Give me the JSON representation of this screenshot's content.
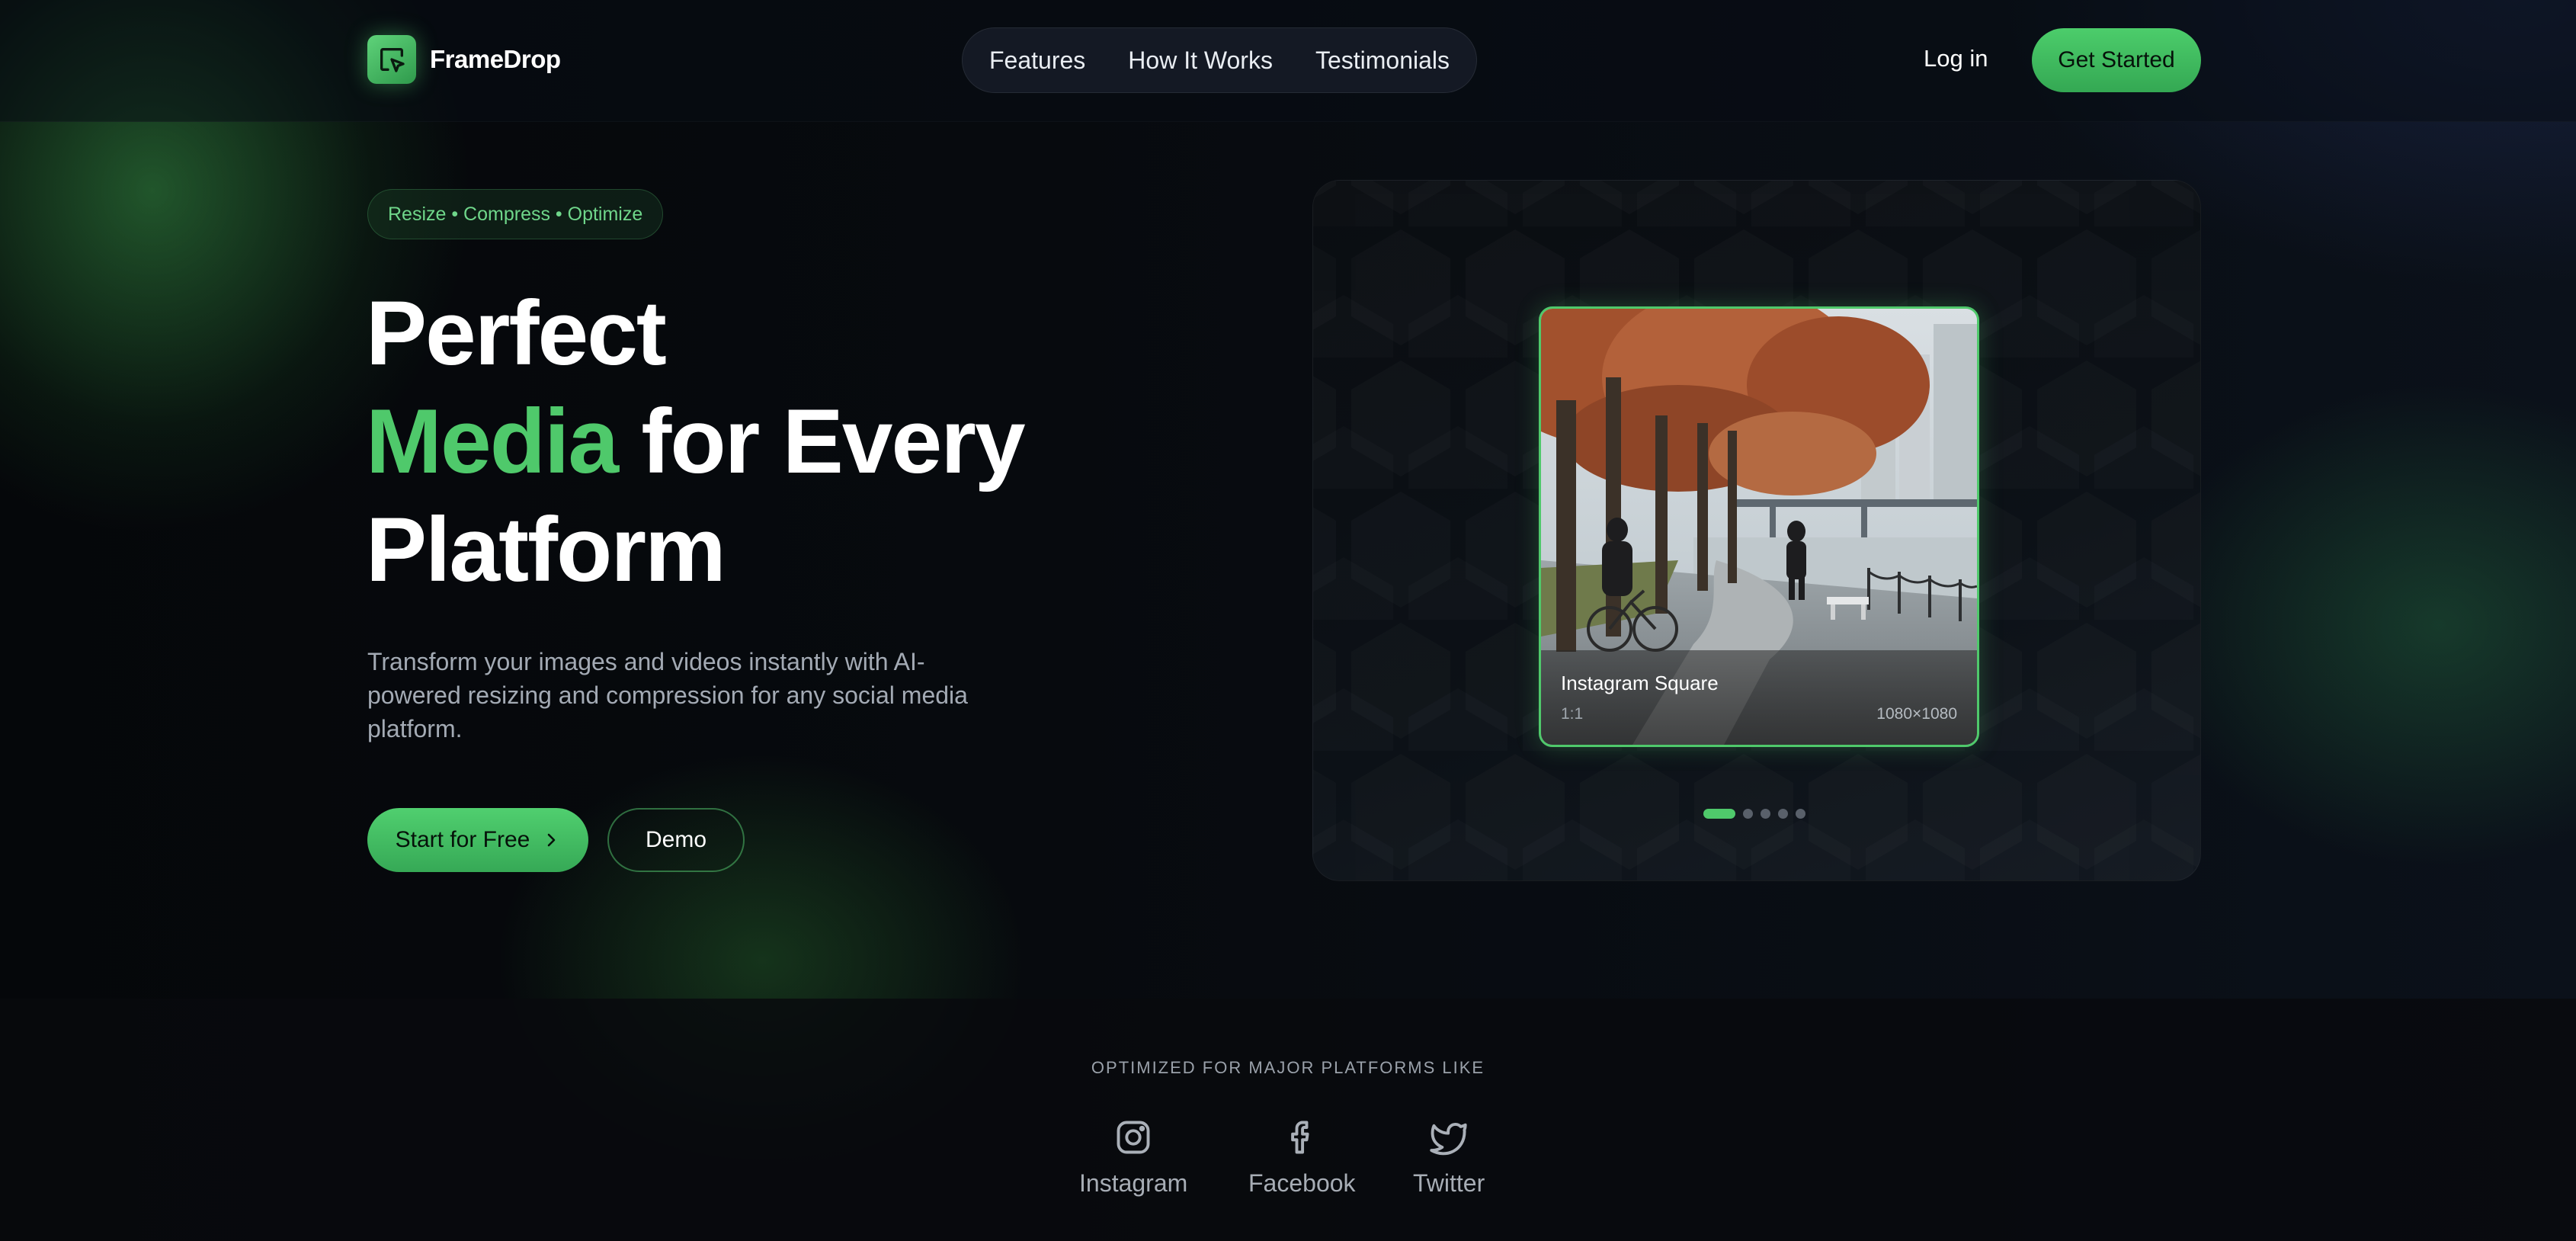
{
  "app": {
    "brand": "FrameDrop"
  },
  "nav": {
    "links": [
      "Features",
      "How It Works",
      "Testimonials"
    ],
    "login": "Log in",
    "cta": "Get Started"
  },
  "hero": {
    "badge": "Resize • Compress • Optimize",
    "headline_line1": "Perfect",
    "headline_accent": "Media",
    "headline_line2_rest": " for Every",
    "headline_line3": "Platform",
    "subtitle": "Transform your images and videos instantly with AI-powered resizing and compression for any social media platform.",
    "primary_button": "Start for Free",
    "secondary_button": "Demo"
  },
  "preview": {
    "card_title": "Instagram Square",
    "card_ratio": "1:1",
    "card_dimensions": "1080×1080",
    "carousel_total": 5,
    "carousel_active": 1
  },
  "platforms": {
    "label": "OPTIMIZED FOR MAJOR PLATFORMS LIKE",
    "items": [
      {
        "name": "Instagram",
        "icon": "instagram-icon"
      },
      {
        "name": "Facebook",
        "icon": "facebook-icon"
      },
      {
        "name": "Twitter",
        "icon": "twitter-icon"
      }
    ]
  },
  "colors": {
    "accent": "#4fc96b",
    "background": "#06080b",
    "muted_text": "#a3aab4"
  }
}
